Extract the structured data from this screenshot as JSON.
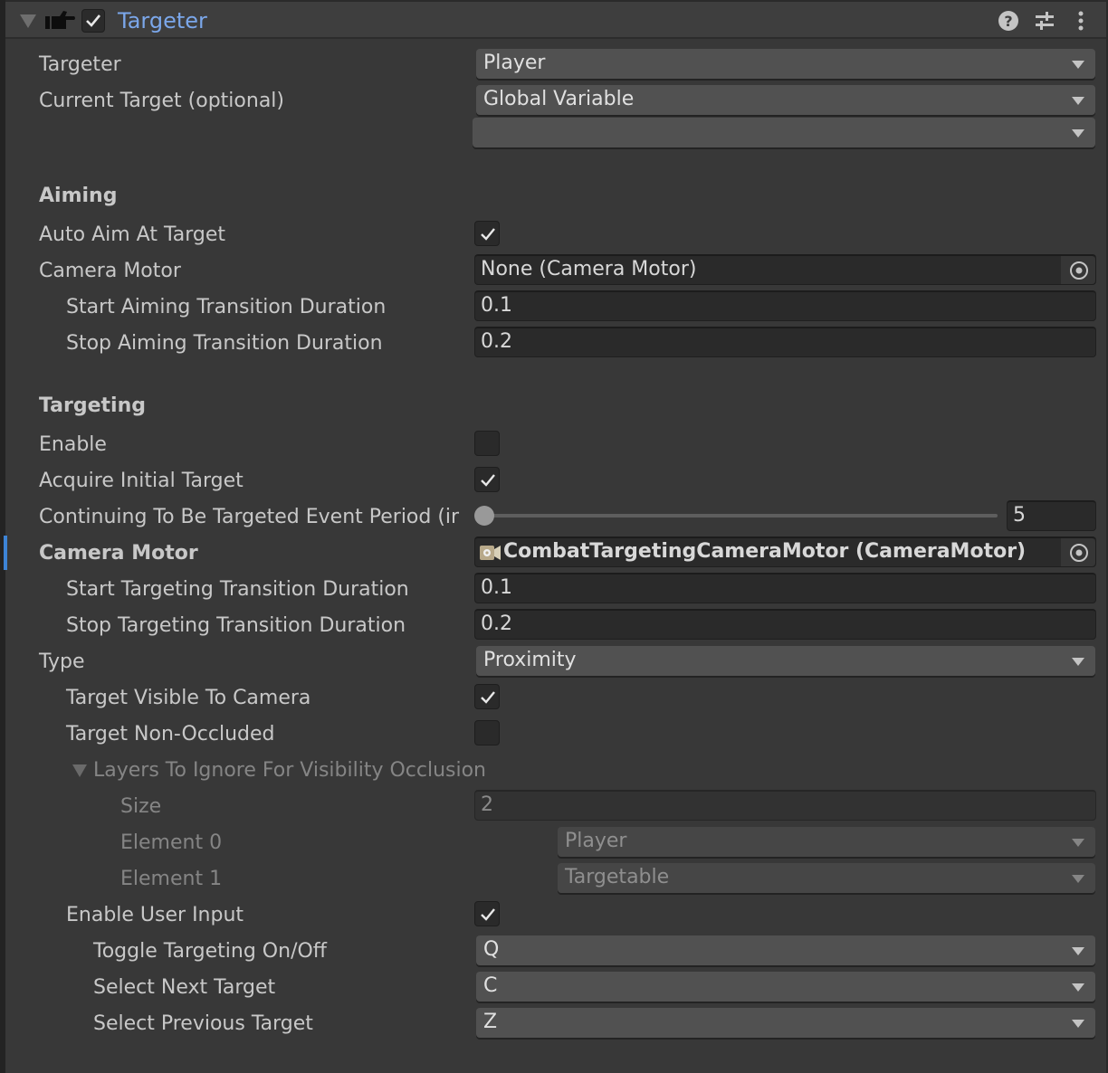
{
  "component": {
    "title": "Targeter",
    "enabled": true,
    "icons": {
      "foldout": "triangle-down-icon",
      "component": "pointing-hand-icon",
      "help": "help-icon",
      "presets": "sliders-icon",
      "menu": "kebab-menu-icon"
    }
  },
  "colors": {
    "title_accent": "#7ba7ea",
    "selection_bar": "#3d84d6",
    "background": "#383838"
  },
  "fields": {
    "targeter": {
      "label": "Targeter",
      "value": "Player"
    },
    "current_target": {
      "label": "Current Target (optional)",
      "value": "Global Variable",
      "sub_value": ""
    },
    "aiming": {
      "header": "Aiming",
      "auto_aim": {
        "label": "Auto Aim At Target",
        "checked": true
      },
      "camera_motor": {
        "label": "Camera Motor",
        "value": "None (Camera Motor)"
      },
      "start_duration": {
        "label": "Start Aiming Transition Duration",
        "value": "0.1"
      },
      "stop_duration": {
        "label": "Stop Aiming Transition Duration",
        "value": "0.2"
      }
    },
    "targeting": {
      "header": "Targeting",
      "enable": {
        "label": "Enable",
        "checked": false
      },
      "acquire_initial": {
        "label": "Acquire Initial Target",
        "checked": true
      },
      "event_period": {
        "label": "Continuing To Be Targeted Event Period (ir",
        "value": "5",
        "slider_fraction": 0.0
      },
      "camera_motor": {
        "label": "Camera Motor",
        "value": "CombatTargetingCameraMotor (CameraMotor)"
      },
      "start_duration": {
        "label": "Start Targeting Transition Duration",
        "value": "0.1"
      },
      "stop_duration": {
        "label": "Stop Targeting Transition Duration",
        "value": "0.2"
      },
      "type": {
        "label": "Type",
        "value": "Proximity"
      },
      "visible_to_camera": {
        "label": "Target Visible To Camera",
        "checked": true
      },
      "non_occluded": {
        "label": "Target Non-Occluded",
        "checked": false
      },
      "layers_ignore": {
        "label": "Layers To Ignore For Visibility Occlusion",
        "size_label": "Size",
        "size": "2",
        "elements": [
          {
            "label": "Element 0",
            "value": "Player"
          },
          {
            "label": "Element 1",
            "value": "Targetable"
          }
        ]
      },
      "user_input": {
        "label": "Enable User Input",
        "checked": true
      },
      "toggle_key": {
        "label": "Toggle Targeting On/Off",
        "value": "Q"
      },
      "next_key": {
        "label": "Select Next Target",
        "value": "C"
      },
      "prev_key": {
        "label": "Select Previous Target",
        "value": "Z"
      }
    }
  }
}
